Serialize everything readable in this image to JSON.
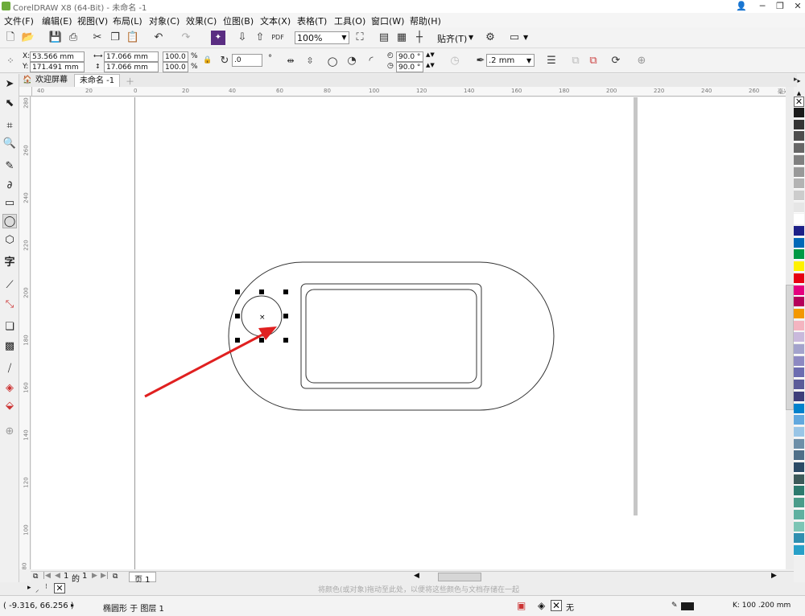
{
  "app": {
    "title": "CorelDRAW X8 (64-Bit) - 未命名 -1"
  },
  "menu": [
    "文件(F)",
    "编辑(E)",
    "视图(V)",
    "布局(L)",
    "对象(C)",
    "效果(C)",
    "位图(B)",
    "文本(X)",
    "表格(T)",
    "工具(O)",
    "窗口(W)",
    "帮助(H)"
  ],
  "toolbar": {
    "zoom": "100%",
    "snap_label": "贴齐(T)",
    "pdf_label": "PDF"
  },
  "property_bar": {
    "x_label": "X:",
    "x_value": "53.566 mm",
    "y_label": "Y:",
    "y_value": "171.491 mm",
    "width_value": "17.066 mm",
    "height_value": "17.066 mm",
    "scale_w": "100.0",
    "scale_h": "100.0",
    "percent": "%",
    "rotation": ".0",
    "start_angle": "90.0 °",
    "end_angle": "90.0 °",
    "outline_width": ".2 mm"
  },
  "tabs": [
    {
      "label": "欢迎屏幕"
    },
    {
      "label": "未命名 -1"
    }
  ],
  "ruler": {
    "h_ticks": [
      "40",
      "20",
      "0",
      "20",
      "40",
      "60",
      "80",
      "100",
      "120",
      "140",
      "160",
      "180",
      "200",
      "220",
      "240",
      "260"
    ],
    "h_unit": "毫米",
    "v_ticks": [
      "280",
      "260",
      "240",
      "220",
      "200",
      "180",
      "160",
      "140",
      "120",
      "100",
      "80"
    ]
  },
  "page_nav": {
    "current": "1",
    "sep": "的",
    "total": "1",
    "page_tab": "页 1"
  },
  "hint": "将颜色(或对象)拖动至此处，以便将这些颜色与文档存储在一起",
  "status": {
    "coords": "( -9.316, 66.256 )",
    "object_info": "椭圆形 于 图层 1",
    "fill_none": "无",
    "tail_values": "K: 100  .200 mm"
  },
  "colors": {
    "accent_arrow": "#e02020",
    "palette": [
      "#1a1a1a",
      "#333333",
      "#4d4d4d",
      "#666666",
      "#808080",
      "#999999",
      "#b3b3b3",
      "#cccccc",
      "#e6e6e6",
      "#ffffff",
      "#1d2088",
      "#0068b7",
      "#009944",
      "#fff100",
      "#e60012",
      "#e4007f",
      "#b5005b",
      "#f39800",
      "#f4b4c0",
      "#c9b9dc",
      "#a3a3cc",
      "#8d89c2",
      "#6c6cb0",
      "#5b5b99",
      "#3e3e7a",
      "#0081cc",
      "#62a8de",
      "#99c5e6",
      "#6d8fa8",
      "#4f6f88",
      "#2b4a66",
      "#3d5a5a",
      "#2d7a6e",
      "#4a9c8a",
      "#5fb0a0",
      "#7cc5b5",
      "#2f8fb0",
      "#28a0c8"
    ]
  }
}
